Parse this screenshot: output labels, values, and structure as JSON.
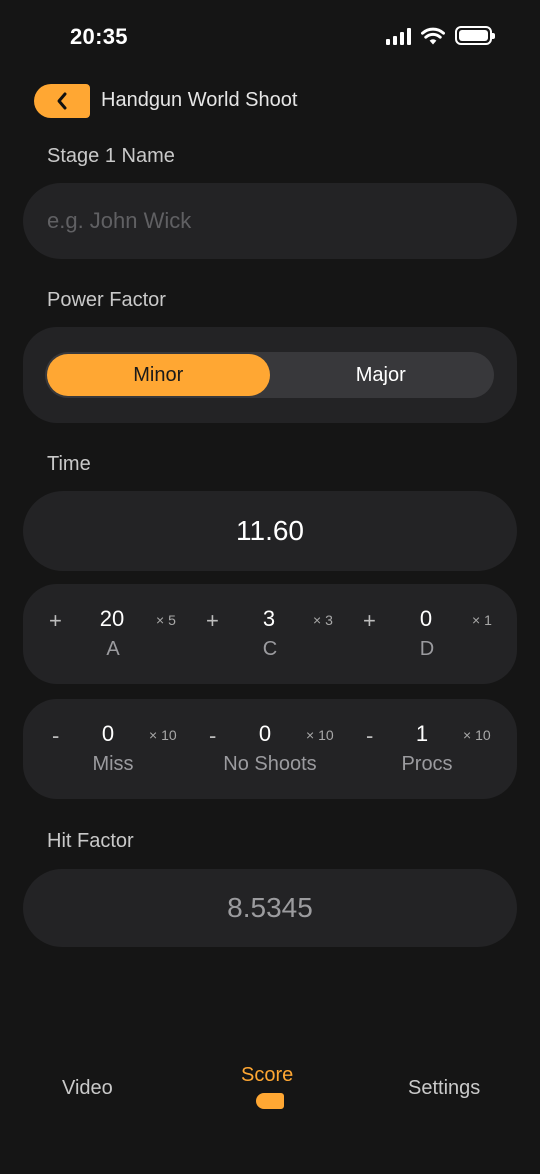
{
  "status_bar": {
    "time": "20:35"
  },
  "header": {
    "title": "Handgun World Shoot"
  },
  "name_section": {
    "label": "Stage 1  Name",
    "placeholder": "e.g. John Wick",
    "value": ""
  },
  "power_factor": {
    "label": "Power Factor",
    "options": [
      "Minor",
      "Major"
    ],
    "selected": "Minor"
  },
  "time_section": {
    "label": "Time",
    "value": "11.60"
  },
  "hits": [
    {
      "sign": "+",
      "count": "20",
      "multiplier": "× 5",
      "label": "A"
    },
    {
      "sign": "+",
      "count": "3",
      "multiplier": "× 3",
      "label": "C"
    },
    {
      "sign": "+",
      "count": "0",
      "multiplier": "× 1",
      "label": "D"
    }
  ],
  "penalties": [
    {
      "sign": "-",
      "count": "0",
      "multiplier": "× 10",
      "label": "Miss"
    },
    {
      "sign": "-",
      "count": "0",
      "multiplier": "× 10",
      "label": "No Shoots"
    },
    {
      "sign": "-",
      "count": "1",
      "multiplier": "× 10",
      "label": "Procs"
    }
  ],
  "hit_factor": {
    "label": "Hit Factor",
    "value": "8.5345"
  },
  "tab_bar": {
    "tabs": [
      "Video",
      "Score",
      "Settings"
    ],
    "active": "Score"
  },
  "colors": {
    "accent": "#FFA733",
    "background": "#151515",
    "card": "#232325"
  }
}
